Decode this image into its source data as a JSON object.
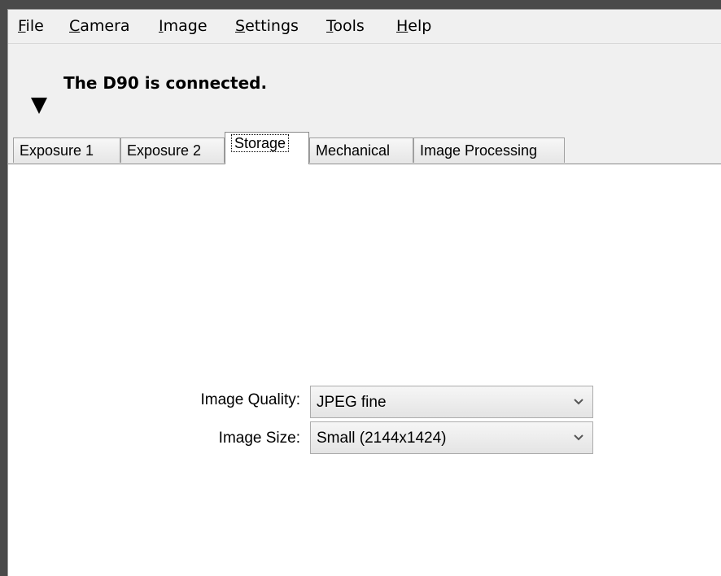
{
  "menu": {
    "items": [
      {
        "label": "File",
        "mnemonic": "F",
        "rest": "ile"
      },
      {
        "label": "Camera",
        "mnemonic": "C",
        "rest": "amera"
      },
      {
        "label": "Image",
        "mnemonic": "I",
        "rest": "mage"
      },
      {
        "label": "Settings",
        "mnemonic": "S",
        "rest": "ettings"
      },
      {
        "label": "Tools",
        "mnemonic": "T",
        "rest": "ools"
      },
      {
        "label": "Help",
        "mnemonic": "H",
        "rest": "elp"
      }
    ]
  },
  "status": {
    "message": "The D90 is connected.",
    "toggle_icon": "triangle-down-icon"
  },
  "tabs": [
    {
      "label": "Exposure 1",
      "active": false
    },
    {
      "label": "Exposure 2",
      "active": false
    },
    {
      "label": "Storage",
      "active": true
    },
    {
      "label": "Mechanical",
      "active": false
    },
    {
      "label": "Image Processing",
      "active": false
    }
  ],
  "storage": {
    "image_quality": {
      "label": "Image Quality:",
      "value": "JPEG fine"
    },
    "image_size": {
      "label": "Image Size:",
      "value": "Small (2144x1424)"
    },
    "dropdown_icon": "chevron-down-icon"
  }
}
